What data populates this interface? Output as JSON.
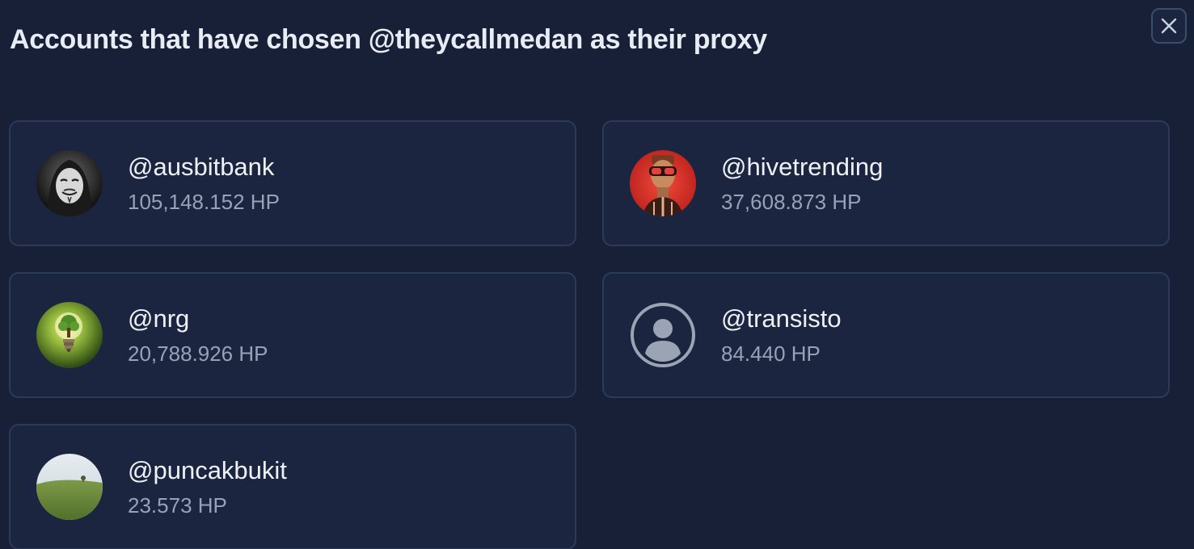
{
  "dialog": {
    "title": "Accounts that have chosen @theycallmedan as their proxy",
    "close_icon": "close-icon"
  },
  "accounts": [
    {
      "name": "@ausbitbank",
      "hp": "105,148.152 HP",
      "avatar": "anonymous-mask-avatar"
    },
    {
      "name": "@hivetrending",
      "hp": "37,608.873 HP",
      "avatar": "robot-goggles-avatar"
    },
    {
      "name": "@nrg",
      "hp": "20,788.926 HP",
      "avatar": "lightbulb-tree-avatar"
    },
    {
      "name": "@transisto",
      "hp": "84.440 HP",
      "avatar": "default-user-avatar"
    },
    {
      "name": "@puncakbukit",
      "hp": "23.573 HP",
      "avatar": "green-hill-avatar"
    }
  ],
  "colors": {
    "background": "#172036",
    "card_background": "#1b2540",
    "card_border": "#2c3a5a",
    "primary_text": "#eef1f7",
    "secondary_text": "#96a2b8"
  }
}
